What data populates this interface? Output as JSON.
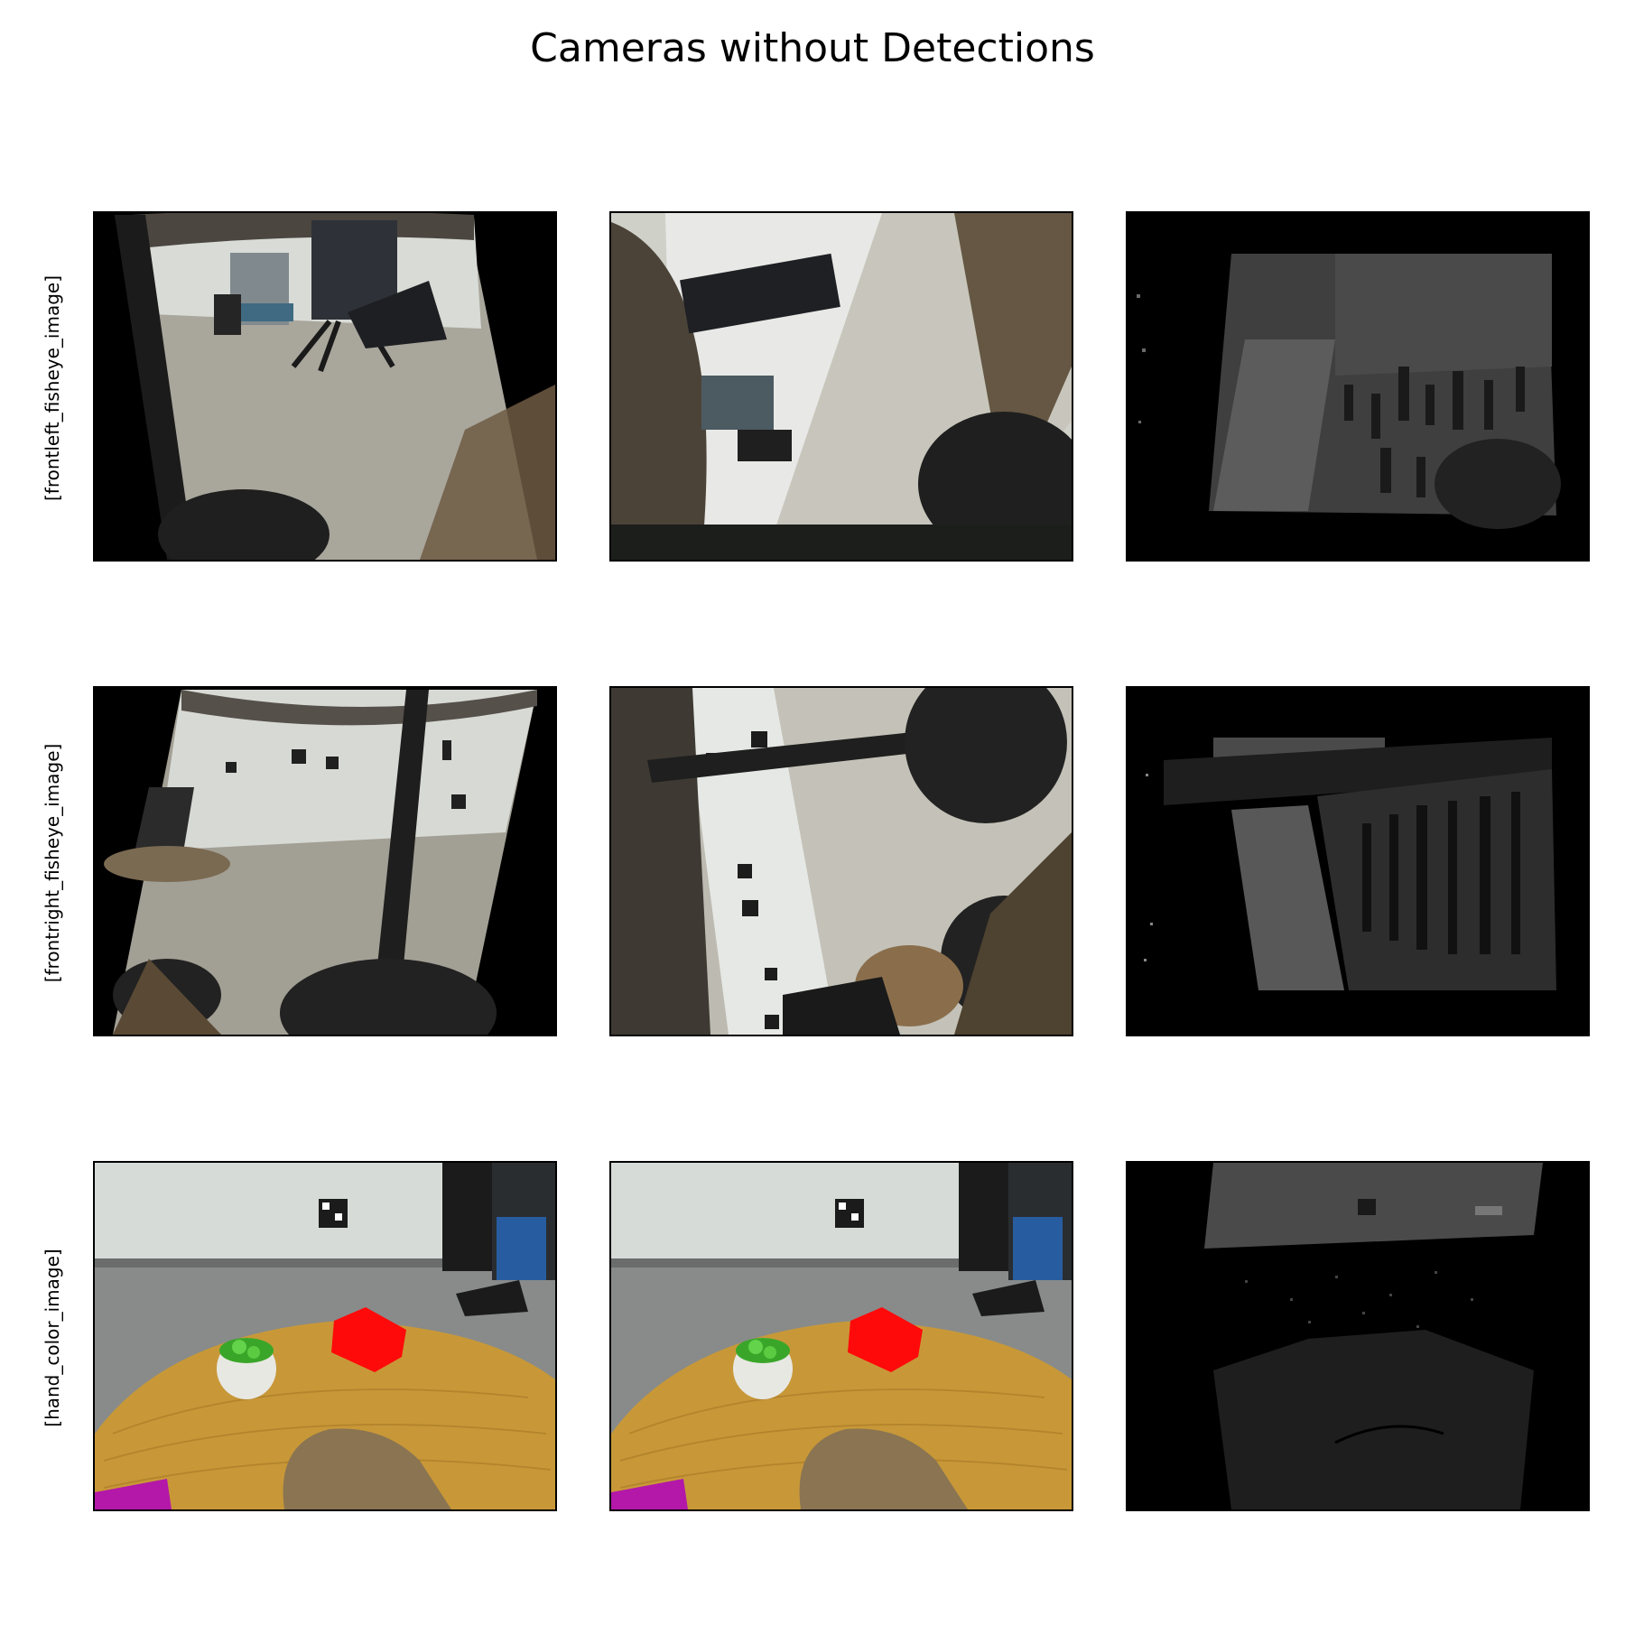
{
  "figure": {
    "title": "Cameras without Detections"
  },
  "rows": [
    {
      "label": "[frontleft_fisheye_image]"
    },
    {
      "label": "[frontright_fisheye_image]"
    },
    {
      "label": "[hand_color_image]"
    }
  ],
  "colors": {
    "background": "#ffffff",
    "frame": "#000000",
    "floor_gray": "#a8a59a",
    "wall_white": "#d9dcd8",
    "table_wood": "#c99a3a",
    "red_box": "#ff0a0a",
    "depth_gray": "#5e5e5e"
  }
}
